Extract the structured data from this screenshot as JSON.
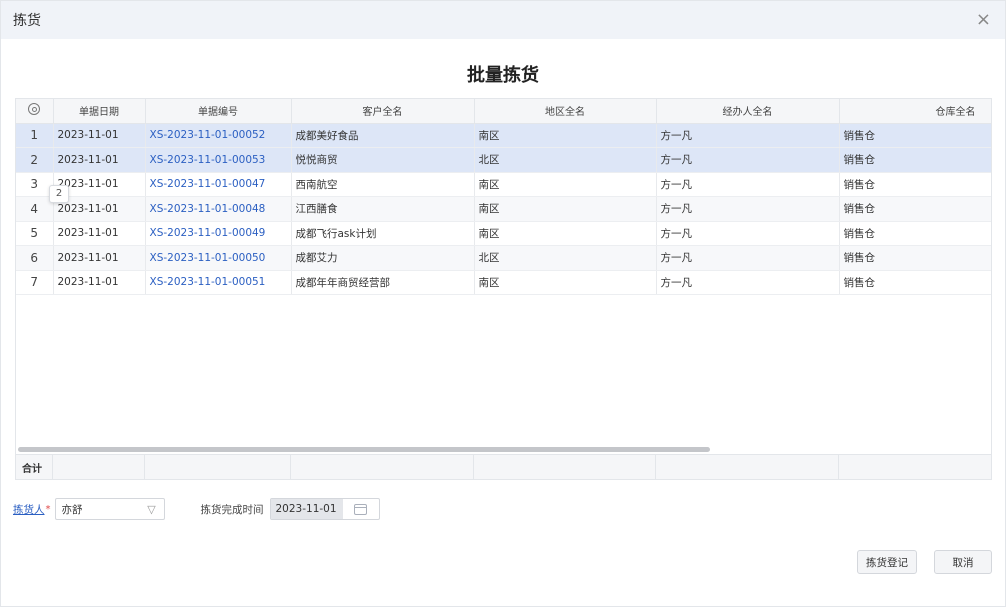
{
  "dialog": {
    "title": "拣货",
    "close_icon": "×"
  },
  "heading": "批量拣货",
  "table": {
    "columns": [
      "单据日期",
      "单据编号",
      "客户全名",
      "地区全名",
      "经办人全名",
      "仓库全名"
    ],
    "rows": [
      {
        "idx": "1",
        "date": "2023-11-01",
        "code": "XS-2023-11-01-00052",
        "customer": "成都美好食品",
        "region": "南区",
        "handler": "方一凡",
        "warehouse": "销售仓",
        "selected": true
      },
      {
        "idx": "2",
        "date": "2023-11-01",
        "code": "XS-2023-11-01-00053",
        "customer": "悦悦商贸",
        "region": "北区",
        "handler": "方一凡",
        "warehouse": "销售仓",
        "selected": true
      },
      {
        "idx": "3",
        "date": "2023-11-01",
        "code": "XS-2023-11-01-00047",
        "customer": "西南航空",
        "region": "南区",
        "handler": "方一凡",
        "warehouse": "销售仓",
        "selected": false
      },
      {
        "idx": "4",
        "date": "2023-11-01",
        "code": "XS-2023-11-01-00048",
        "customer": "江西膳食",
        "region": "南区",
        "handler": "方一凡",
        "warehouse": "销售仓",
        "selected": false
      },
      {
        "idx": "5",
        "date": "2023-11-01",
        "code": "XS-2023-11-01-00049",
        "customer": "成都飞行ask计划",
        "region": "南区",
        "handler": "方一凡",
        "warehouse": "销售仓",
        "selected": false
      },
      {
        "idx": "6",
        "date": "2023-11-01",
        "code": "XS-2023-11-01-00050",
        "customer": "成都艾力",
        "region": "北区",
        "handler": "方一凡",
        "warehouse": "销售仓",
        "selected": false
      },
      {
        "idx": "7",
        "date": "2023-11-01",
        "code": "XS-2023-11-01-00051",
        "customer": "成都年年商贸经营部",
        "region": "南区",
        "handler": "方一凡",
        "warehouse": "销售仓",
        "selected": false
      }
    ],
    "footer_label": "合计",
    "tooltip": "2"
  },
  "form": {
    "picker_label": "拣货人",
    "required_mark": "*",
    "picker_value": "亦舒",
    "time_label": "拣货完成时间",
    "time_value": "2023-11-01"
  },
  "buttons": {
    "register": "拣货登记",
    "cancel": "取消"
  }
}
